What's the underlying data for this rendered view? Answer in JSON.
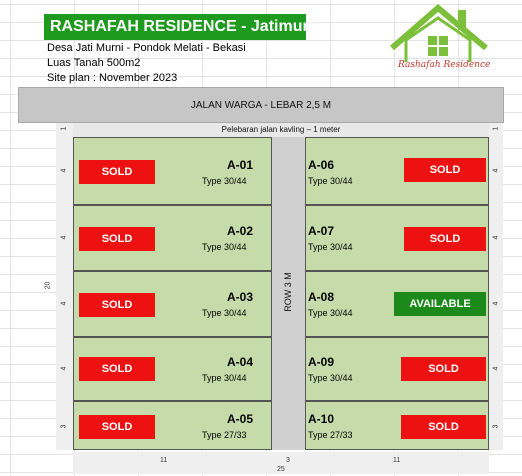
{
  "header": {
    "title": "RASHAFAH RESIDENCE - Jatimurni",
    "address": "Desa Jati Murni - Pondok Melati - Bekasi",
    "area": "Luas Tanah 500m2",
    "siteplan": "Site plan : November 2023",
    "logo_text": "Rashafah Residence"
  },
  "roads": {
    "main": "JALAN WARGA - LEBAR 2,5 M",
    "widening": "Pelebaran jalan kavling – 1 meter",
    "row": "ROW 3 M"
  },
  "dimensions": {
    "top_margin": "1",
    "left_total": "20",
    "left_col": "11",
    "row_width": "3",
    "right_col": "11",
    "total_width": "25",
    "lot_rows": [
      "4",
      "4",
      "4",
      "4",
      "3"
    ]
  },
  "lots_left": [
    {
      "id": "A-01",
      "type": "Type 30/44",
      "status": "SOLD"
    },
    {
      "id": "A-02",
      "type": "Type 30/44",
      "status": "SOLD"
    },
    {
      "id": "A-03",
      "type": "Type 30/44",
      "status": "SOLD"
    },
    {
      "id": "A-04",
      "type": "Type 30/44",
      "status": "SOLD"
    },
    {
      "id": "A-05",
      "type": "Type 27/33",
      "status": "SOLD"
    }
  ],
  "lots_right": [
    {
      "id": "A-06",
      "type": "Type 30/44",
      "status": "SOLD"
    },
    {
      "id": "A-07",
      "type": "Type 30/44",
      "status": "SOLD"
    },
    {
      "id": "A-08",
      "type": "Type 30/44",
      "status": "AVAILABLE"
    },
    {
      "id": "A-09",
      "type": "Type 30/44",
      "status": "SOLD"
    },
    {
      "id": "A-10",
      "type": "Type 27/33",
      "status": "SOLD"
    }
  ],
  "colors": {
    "title_bg": "#1e9a1e",
    "lot_fill": "#c5dcaa",
    "sold": "#ee1111",
    "available": "#1b8a1b",
    "road": "#c6c6c6"
  }
}
